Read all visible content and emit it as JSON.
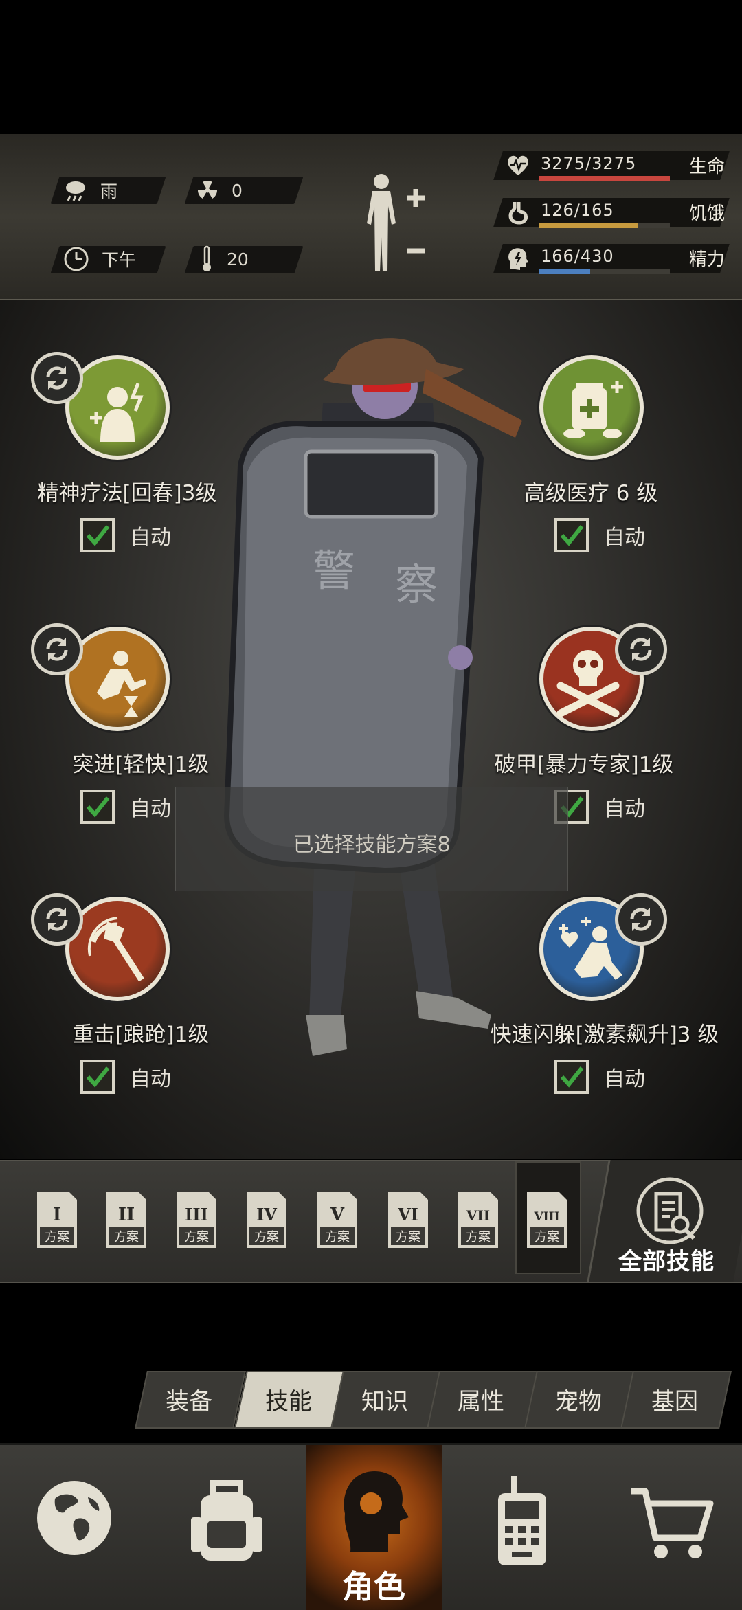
{
  "status": {
    "weather": {
      "icon": "rain-cloud-icon",
      "label": "雨"
    },
    "radiation": {
      "icon": "radiation-icon",
      "value": "0"
    },
    "time": {
      "icon": "clock-icon",
      "label": "下午"
    },
    "temperature": {
      "icon": "thermometer-icon",
      "value": "20"
    },
    "stats": [
      {
        "name": "health",
        "icon": "heart-icon",
        "value": "3275/3275",
        "label": "生命",
        "fill": 1.0,
        "color": "#c8463e"
      },
      {
        "name": "hunger",
        "icon": "stomach-icon",
        "value": "126/165",
        "label": "饥饿",
        "fill": 0.76,
        "color": "#c79a3e"
      },
      {
        "name": "energy",
        "icon": "brain-bolt-icon",
        "value": "166/430",
        "label": "精力",
        "fill": 0.39,
        "color": "#4c7fbf"
      }
    ]
  },
  "skills": [
    {
      "name": "精神疗法[回春]3级",
      "auto": "自动",
      "checked": true,
      "icon": "mental-therapy-icon",
      "color": "#7d9a35",
      "refresh": true
    },
    {
      "name": "高级医疗 6 级",
      "auto": "自动",
      "checked": true,
      "icon": "medkit-icon",
      "color": "#6f9234",
      "refresh": false
    },
    {
      "name": "突进[轻快]1级",
      "auto": "自动",
      "checked": true,
      "icon": "dash-hourglass-icon",
      "color": "#b07222",
      "refresh": true
    },
    {
      "name": "破甲[暴力专家]1级",
      "auto": "自动",
      "checked": true,
      "icon": "skull-crossbones-icon",
      "color": "#9a3320",
      "refresh": true
    },
    {
      "name": "重击[踉跄]1级",
      "auto": "自动",
      "checked": true,
      "icon": "axe-strike-icon",
      "color": "#9b3a20",
      "refresh": true
    },
    {
      "name": "快速闪躲[激素飙升]3 级",
      "auto": "自动",
      "checked": true,
      "icon": "dodge-icon",
      "color": "#2c5f9a",
      "refresh": true
    }
  ],
  "toast": "已选择技能方案8",
  "plans": {
    "numerals": [
      "I",
      "II",
      "III",
      "IV",
      "V",
      "VI",
      "VII",
      "VIII"
    ],
    "label": "方案",
    "selected_index": 7
  },
  "all_skills_label": "全部技能",
  "tabs": [
    "装备",
    "技能",
    "知识",
    "属性",
    "宠物",
    "基因"
  ],
  "active_tab_index": 1,
  "nav": {
    "items": [
      "globe-icon",
      "backpack-icon",
      "character-icon",
      "radio-icon",
      "cart-icon"
    ],
    "active_label": "角色"
  }
}
